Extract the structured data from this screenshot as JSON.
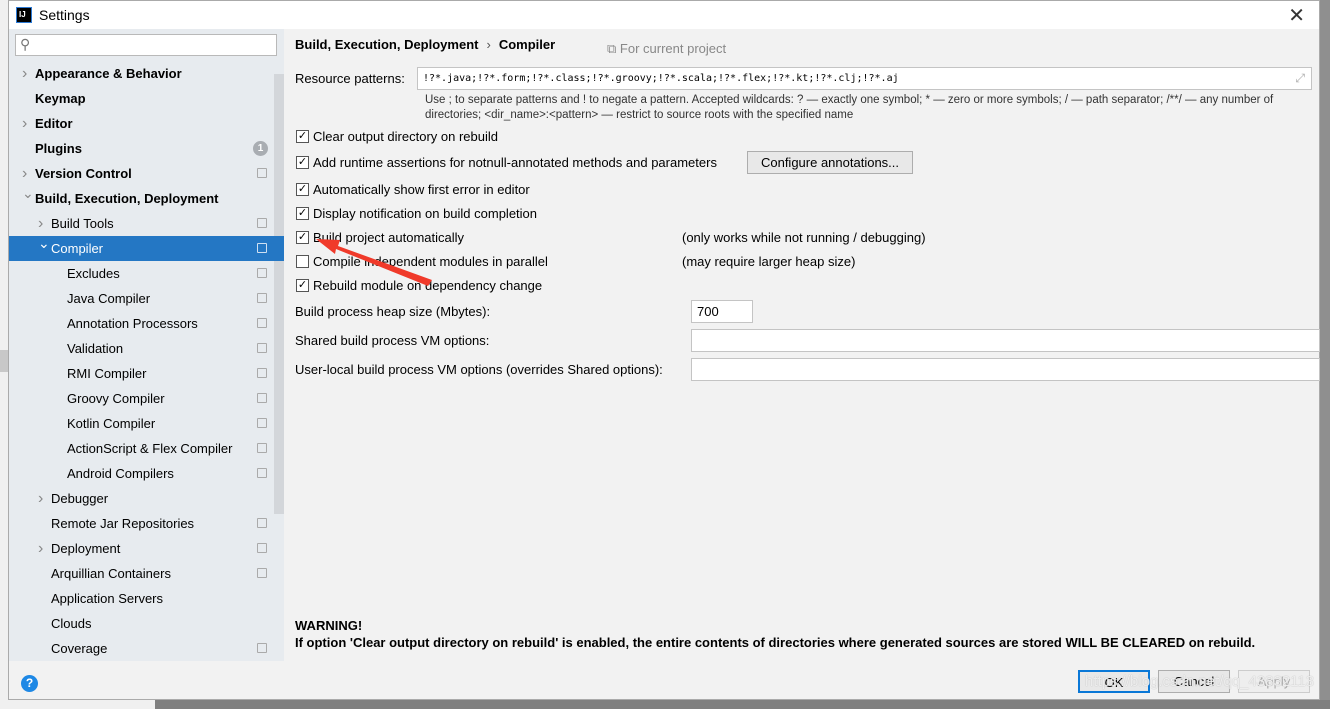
{
  "window": {
    "title": "Settings",
    "app_icon": "IJ"
  },
  "search": {
    "placeholder": ""
  },
  "sidebar": {
    "items": [
      {
        "label": "Appearance & Behavior",
        "level": 0,
        "arrow": "right",
        "bold": true
      },
      {
        "label": "Keymap",
        "level": 0,
        "bold": true
      },
      {
        "label": "Editor",
        "level": 0,
        "arrow": "right",
        "bold": true
      },
      {
        "label": "Plugins",
        "level": 0,
        "bold": true,
        "badge": "1"
      },
      {
        "label": "Version Control",
        "level": 0,
        "arrow": "right",
        "bold": true,
        "project": true
      },
      {
        "label": "Build, Execution, Deployment",
        "level": 0,
        "arrow": "down",
        "bold": true
      },
      {
        "label": "Build Tools",
        "level": 1,
        "arrow": "right",
        "project": true
      },
      {
        "label": "Compiler",
        "level": 1,
        "arrow": "down",
        "project": true,
        "selected": true
      },
      {
        "label": "Excludes",
        "level": 2,
        "project": true
      },
      {
        "label": "Java Compiler",
        "level": 2,
        "project": true
      },
      {
        "label": "Annotation Processors",
        "level": 2,
        "project": true
      },
      {
        "label": "Validation",
        "level": 2,
        "project": true
      },
      {
        "label": "RMI Compiler",
        "level": 2,
        "project": true
      },
      {
        "label": "Groovy Compiler",
        "level": 2,
        "project": true
      },
      {
        "label": "Kotlin Compiler",
        "level": 2,
        "project": true
      },
      {
        "label": "ActionScript & Flex Compiler",
        "level": 2,
        "project": true
      },
      {
        "label": "Android Compilers",
        "level": 2,
        "project": true
      },
      {
        "label": "Debugger",
        "level": 1,
        "arrow": "right"
      },
      {
        "label": "Remote Jar Repositories",
        "level": 1,
        "project": true
      },
      {
        "label": "Deployment",
        "level": 1,
        "arrow": "right",
        "project": true
      },
      {
        "label": "Arquillian Containers",
        "level": 1,
        "project": true
      },
      {
        "label": "Application Servers",
        "level": 1
      },
      {
        "label": "Clouds",
        "level": 1
      },
      {
        "label": "Coverage",
        "level": 1,
        "project": true
      }
    ]
  },
  "breadcrumb": {
    "parent": "Build, Execution, Deployment",
    "separator": "›",
    "current": "Compiler",
    "scope": "For current project"
  },
  "resource": {
    "label": "Resource patterns:",
    "value": "!?*.java;!?*.form;!?*.class;!?*.groovy;!?*.scala;!?*.flex;!?*.kt;!?*.clj;!?*.aj",
    "hint_line1": "Use ; to separate patterns and ! to negate a pattern. Accepted wildcards: ? — exactly one symbol; * — zero or more symbols; / — path separator; /**/ — any number of",
    "hint_line2": "directories; <dir_name>:<pattern> — restrict to source roots with the specified name"
  },
  "options": [
    {
      "label": "Clear output directory on rebuild",
      "checked": true
    },
    {
      "label": "Add runtime assertions for notnull-annotated methods and parameters",
      "checked": true
    },
    {
      "label": "Automatically show first error in editor",
      "checked": true
    },
    {
      "label": "Display notification on build completion",
      "checked": true
    },
    {
      "label": "Build project automatically",
      "checked": true,
      "note": "(only works while not running / debugging)"
    },
    {
      "label": "Compile independent modules in parallel",
      "checked": false,
      "note": "(may require larger heap size)"
    },
    {
      "label": "Rebuild module on dependency change",
      "checked": true
    }
  ],
  "configure_button": "Configure annotations...",
  "heap": {
    "label": "Build process heap size (Mbytes):",
    "value": "700"
  },
  "shared_vm": {
    "label": "Shared build process VM options:",
    "value": ""
  },
  "local_vm": {
    "label": "User-local build process VM options (overrides Shared options):",
    "value": ""
  },
  "warning": {
    "title": "WARNING!",
    "text": "If option 'Clear output directory on rebuild' is enabled, the entire contents of directories where generated sources are stored WILL BE CLEARED on rebuild."
  },
  "footer": {
    "ok": "OK",
    "cancel": "Cancel",
    "apply": "Apply",
    "help": "?"
  },
  "watermark": "https://blog.csdn.net/qq_43832113",
  "annotation": {
    "arrow_color": "#f03a2a"
  },
  "colors": {
    "selection": "#2477c4",
    "sidebar_bg": "#e7ebef",
    "content_bg": "#f2f2f2"
  }
}
